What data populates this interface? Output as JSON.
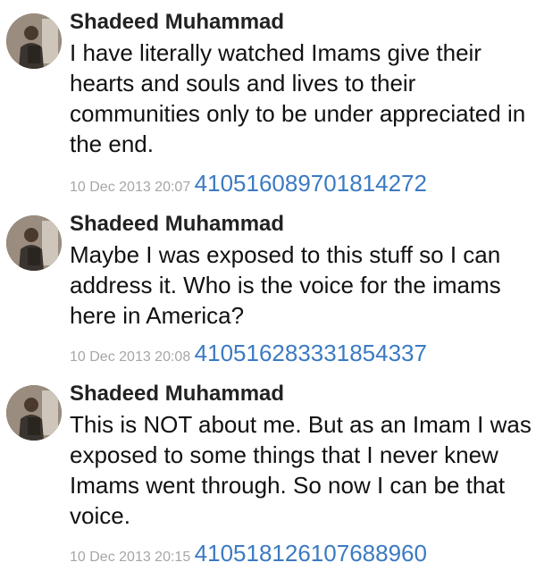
{
  "tweets": [
    {
      "author": "Shadeed Muhammad",
      "avatar_icon": "profile-photo-icon",
      "text": "I have literally watched Imams give their hearts and souls and lives to their communities only to be under appreciated in the end.",
      "date": "10 Dec 2013 20:07",
      "id": "410516089701814272"
    },
    {
      "author": "Shadeed Muhammad",
      "avatar_icon": "profile-photo-icon",
      "text": "Maybe I was exposed to this stuff so I can address it. Who is the voice for the imams here in America?",
      "date": "10 Dec 2013 20:08",
      "id": "410516283331854337"
    },
    {
      "author": "Shadeed Muhammad",
      "avatar_icon": "profile-photo-icon",
      "text": "This is NOT about me. But as an Imam I was exposed to some things that I never knew Imams went through. So now I can be that voice.",
      "date": "10 Dec 2013 20:15",
      "id": "410518126107688960"
    }
  ],
  "colors": {
    "link": "#3b7ac2",
    "date": "#a6a6a6",
    "name": "#222222"
  }
}
